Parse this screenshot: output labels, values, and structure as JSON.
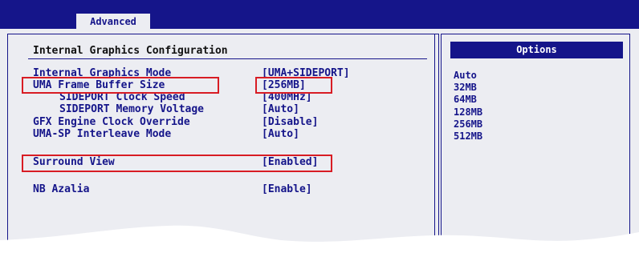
{
  "tabs": {
    "active": "Advanced"
  },
  "section": {
    "title": "Internal Graphics Configuration"
  },
  "settings": [
    {
      "label": "Internal Graphics Mode",
      "value": "[UMA+SIDEPORT]"
    },
    {
      "label": "UMA Frame Buffer Size",
      "value": "[256MB]"
    },
    {
      "label": "SIDEPORT Clock Speed",
      "value": "[400MHz]"
    },
    {
      "label": "SIDEPORT Memory Voltage",
      "value": "[Auto]"
    },
    {
      "label": "GFX Engine Clock Override",
      "value": "[Disable]"
    },
    {
      "label": "UMA-SP Interleave Mode",
      "value": "[Auto]"
    },
    {
      "label": "Surround View",
      "value": "[Enabled]"
    },
    {
      "label": "NB Azalia",
      "value": "[Enable]"
    }
  ],
  "options": {
    "header": "Options",
    "items": [
      "Auto",
      "32MB",
      "64MB",
      "128MB",
      "256MB",
      "512MB"
    ]
  },
  "colors": {
    "bios_blue": "#15158a",
    "panel_gray": "#ecedf2",
    "highlight_red": "#d81c24"
  }
}
